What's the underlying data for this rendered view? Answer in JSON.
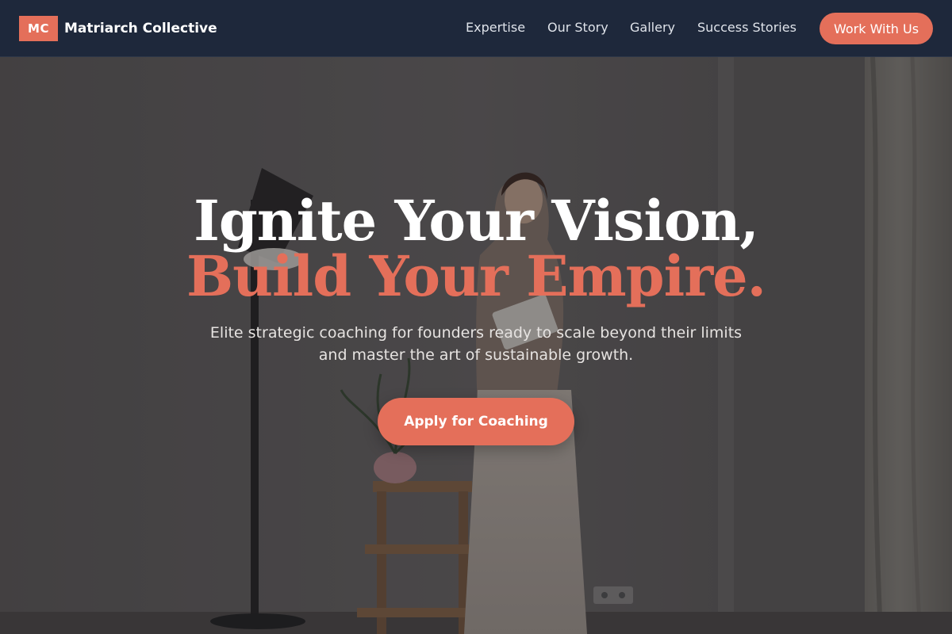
{
  "brand": {
    "badge": "MC",
    "name": "Matriarch Collective"
  },
  "nav": {
    "links": [
      {
        "label": "Expertise"
      },
      {
        "label": "Our Story"
      },
      {
        "label": "Gallery"
      },
      {
        "label": "Success Stories"
      }
    ],
    "cta_label": "Work With Us"
  },
  "hero": {
    "headline_line1": "Ignite Your Vision,",
    "headline_line2": "Build Your Empire.",
    "subtext": "Elite strategic coaching for founders ready to scale beyond their limits and master the art of sustainable growth.",
    "cta_label": "Apply for Coaching",
    "background_image": "woman-standing-in-studio-photo"
  },
  "colors": {
    "nav_background": "#1e283b",
    "accent": "#e46f5a",
    "headline_white": "#ffffff"
  }
}
